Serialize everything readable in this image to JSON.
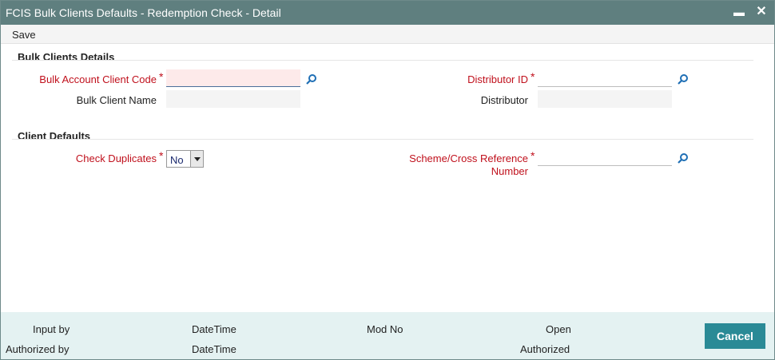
{
  "window": {
    "title": "FCIS Bulk Clients Defaults - Redemption Check - Detail",
    "minimize_label": "▬",
    "close_label": "✕"
  },
  "toolbar": {
    "save_label": "Save"
  },
  "bulk_clients_details": {
    "heading": "Bulk Clients Details",
    "bulk_account_client_code": {
      "label": "Bulk Account Client Code",
      "required_mark": "*",
      "value": ""
    },
    "bulk_client_name": {
      "label": "Bulk Client Name",
      "value": ""
    },
    "distributor_id": {
      "label": "Distributor ID",
      "required_mark": "*",
      "value": ""
    },
    "distributor": {
      "label": "Distributor",
      "value": ""
    }
  },
  "client_defaults": {
    "heading": "Client Defaults",
    "check_duplicates": {
      "label": "Check Duplicates",
      "required_mark": "*",
      "selected": "No"
    },
    "scheme_cross_reference": {
      "label_line1": "Scheme/Cross Reference",
      "label_line2": "Number",
      "required_mark": "*",
      "value": ""
    }
  },
  "footer": {
    "input_by": "Input by",
    "authorized_by": "Authorized by",
    "datetime_1": "DateTime",
    "datetime_2": "DateTime",
    "mod_no": "Mod No",
    "open": "Open",
    "authorized": "Authorized",
    "cancel_label": "Cancel"
  },
  "colors": {
    "titlebar": "#5f7f7f",
    "required": "#c0101c",
    "footer_bg": "#e4f2f2",
    "cancel_button": "#2a8a96",
    "lookup_icon": "#1f6fb5"
  },
  "icons": {
    "lookup": "search-icon"
  }
}
